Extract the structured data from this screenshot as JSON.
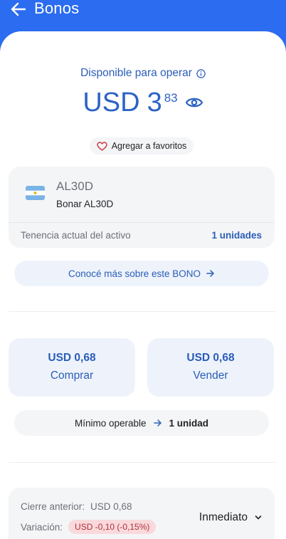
{
  "header": {
    "title": "Bonos",
    "back_icon": "arrow-left-icon"
  },
  "balance": {
    "available_label": "Disponible para operar",
    "currency": "USD",
    "integer": "3",
    "decimals": "83",
    "accent": "#2c63c6"
  },
  "favorites": {
    "label": "Agregar a favoritos"
  },
  "asset": {
    "ticker": "AL30D",
    "name": "Bonar AL30D",
    "holding_label": "Tenencia actual del activo",
    "holding_value": "1 unidades"
  },
  "learn_more": {
    "label": "Conocé más sobre este BONO"
  },
  "trade": {
    "buy": {
      "price": "USD  0,68",
      "label": "Comprar"
    },
    "sell": {
      "price": "USD  0,68",
      "label": "Vender"
    }
  },
  "minimum": {
    "label": "Mínimo operable",
    "value": "1 unidad"
  },
  "stats": {
    "prev_close_label": "Cierre anterior:",
    "prev_close_value": "USD  0,68",
    "variation_label": "Variación:",
    "variation_value": "USD -0,10 (-0,15%)",
    "settlement": "Inmediato"
  },
  "colors": {
    "header": "#2b6cf0",
    "accent": "#2a5db8",
    "negative": "#b0303c"
  }
}
